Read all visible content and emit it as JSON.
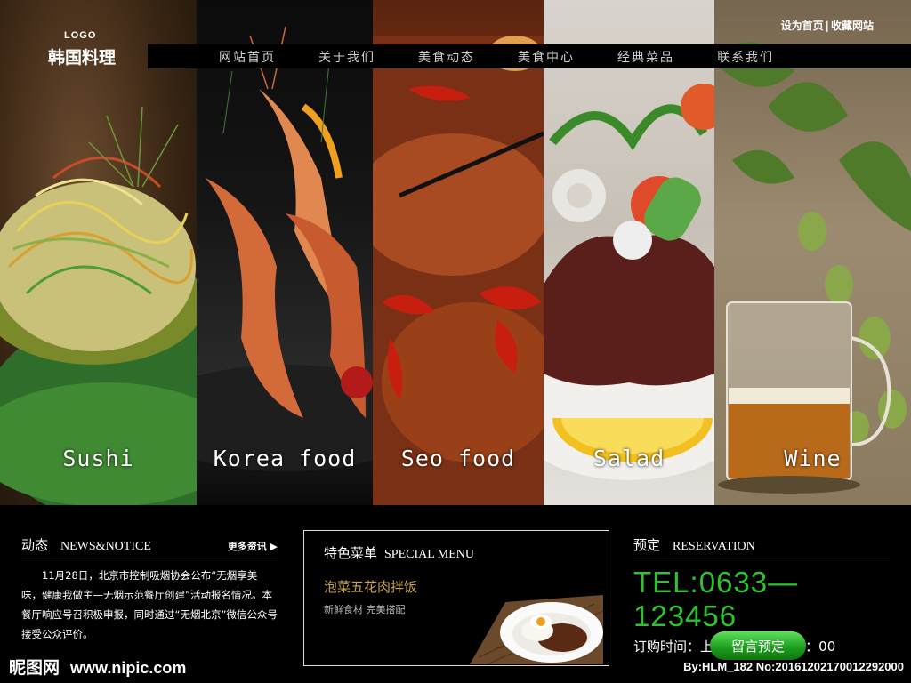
{
  "logo": {
    "small": "LOGO",
    "text": "韩国料理"
  },
  "top_links": {
    "home": "设为首页",
    "separator": "|",
    "favorite": "收藏网站"
  },
  "nav": [
    "网站首页",
    "关于我们",
    "美食动态",
    "美食中心",
    "经典菜品",
    "联系我们"
  ],
  "panels": [
    {
      "label": "Sushi"
    },
    {
      "label": "Korea food"
    },
    {
      "label": "Seo food"
    },
    {
      "label": "Salad"
    },
    {
      "label": "Wine"
    }
  ],
  "news": {
    "title_cn": "动态",
    "title_en": "NEWS&NOTICE",
    "more": "更多资讯 ▶",
    "body": "11月28日，北京市控制吸烟协会公布“无烟享美味，健康我做主—无烟示范餐厅创建”活动报名情况。本餐厅响应号召积极申报，同时通过“无烟北京”微信公众号接受公众评价。"
  },
  "special": {
    "title_cn": "特色菜单",
    "title_en": "SPECIAL MENU",
    "dish": "泡菜五花肉拌饭",
    "sub": "新鲜食材 完美搭配"
  },
  "reservation": {
    "title_cn": "预定",
    "title_en": "RESERVATION",
    "tel": "TEL:0633—123456",
    "hours": "订购时间：上午10:00-下午6：00",
    "button": "留言预定"
  },
  "footer": {
    "site": "昵图网",
    "url": "www.nipic.com",
    "byline": "By:HLM_182 No:20161202170012292000"
  },
  "colors": {
    "accent_green": "#2ec22e",
    "dish_gold": "#c9a44a",
    "nav_bg": "#000000"
  }
}
